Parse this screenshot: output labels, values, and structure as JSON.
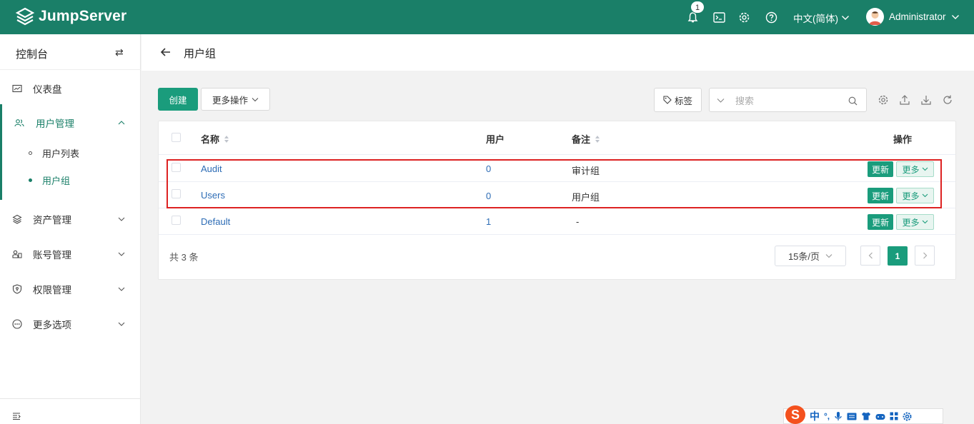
{
  "app": {
    "name": "JumpServer",
    "notification_count": "1"
  },
  "header": {
    "language": "中文(简体)",
    "user": "Administrator"
  },
  "sidebar": {
    "title": "控制台",
    "items": [
      {
        "label": "仪表盘",
        "icon": "dashboard-icon"
      },
      {
        "label": "用户管理",
        "icon": "users-icon",
        "expanded": true
      },
      {
        "label": "资产管理",
        "icon": "assets-icon"
      },
      {
        "label": "账号管理",
        "icon": "accounts-icon"
      },
      {
        "label": "权限管理",
        "icon": "permission-icon"
      },
      {
        "label": "更多选项",
        "icon": "more-options-icon"
      }
    ],
    "sub_items": [
      {
        "label": "用户列表",
        "active": false
      },
      {
        "label": "用户组",
        "active": true
      }
    ]
  },
  "page": {
    "title": "用户组"
  },
  "toolbar": {
    "create_label": "创建",
    "more_actions_label": "更多操作",
    "tag_label": "标签",
    "search_placeholder": "搜索"
  },
  "table": {
    "columns": {
      "name": "名称",
      "users": "用户",
      "comment": "备注",
      "actions": "操作"
    },
    "rows": [
      {
        "name": "Audit",
        "users": "0",
        "comment": "审计组"
      },
      {
        "name": "Users",
        "users": "0",
        "comment": "用户组"
      },
      {
        "name": "Default",
        "users": "1",
        "comment": "-"
      }
    ],
    "update_label": "更新",
    "more_label": "更多"
  },
  "pagination": {
    "total": "共 3 条",
    "page_size": "15条/页",
    "current_page": "1"
  },
  "colors": {
    "brand": "#1a7f68",
    "primary": "#1a9c7c",
    "link": "#2d6cb5",
    "highlight": "#dd2222"
  },
  "ime": {
    "mode": "中",
    "punct": "°,"
  }
}
